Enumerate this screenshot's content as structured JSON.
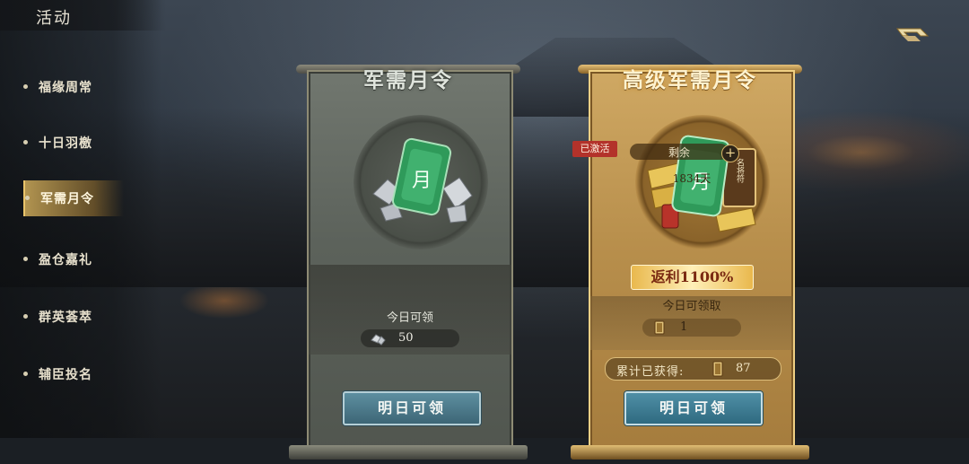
{
  "page": {
    "title": "活动"
  },
  "sidebar": {
    "items": [
      {
        "label": "福缘周常",
        "active": false
      },
      {
        "label": "十日羽檄",
        "active": false
      },
      {
        "label": "军需月令",
        "active": true
      },
      {
        "label": "盈仓嘉礼",
        "active": false
      },
      {
        "label": "群英荟萃",
        "active": false
      },
      {
        "label": "辅臣投名",
        "active": false
      }
    ]
  },
  "icons": {
    "back": "back-arrow-icon",
    "basic_emblem": "jade-moon-token-icon",
    "premium_emblem": "dragon-jade-token-icon",
    "silver": "silver-ingot-icon",
    "token": "token-card-icon"
  },
  "colors": {
    "accent_gold": "#e9c46a",
    "button_blue": "#3d6676",
    "activated_red": "#b3322a"
  },
  "cards": {
    "basic": {
      "title": "军需月令",
      "emblem_char": "月",
      "daily_label": "今日可领",
      "daily_value": "50",
      "button_label": "明日可领"
    },
    "premium": {
      "title": "高级军需月令",
      "activated_label": "已激活",
      "remaining_label": "剩余",
      "remaining_days": "1834天",
      "plus_label": "+",
      "emblem_char": "月",
      "seal_text": "名将符",
      "rebate_label": "返利1100%",
      "daily_label": "今日可领取",
      "daily_value": "1",
      "total_label": "累计已获得:",
      "total_value": "87",
      "button_label": "明日可领"
    }
  }
}
